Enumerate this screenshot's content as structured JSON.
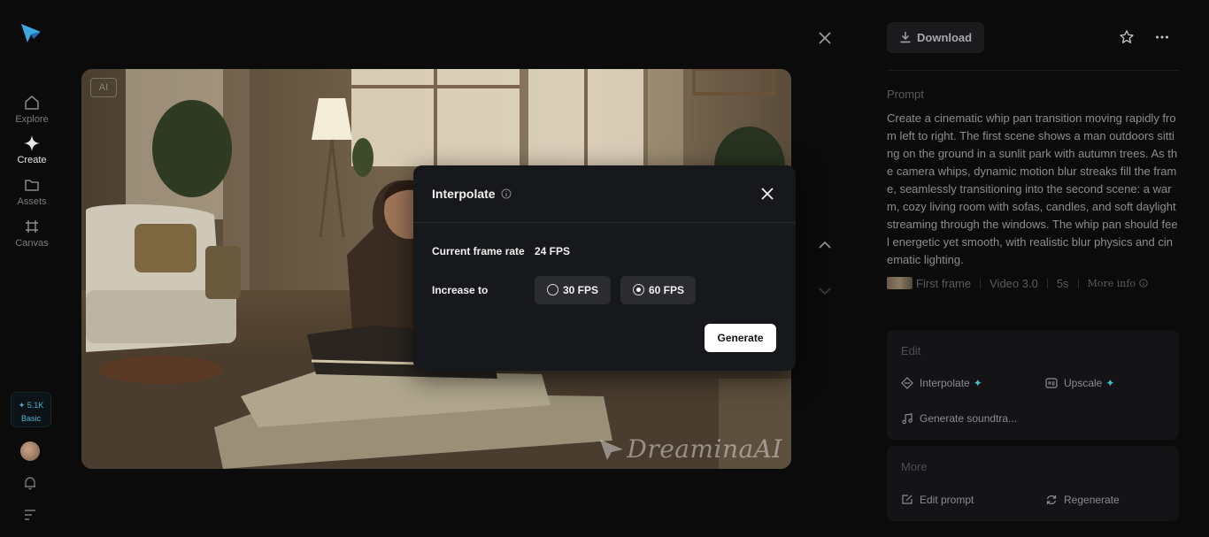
{
  "nav": {
    "items": [
      {
        "label": "Explore",
        "icon": "home-icon"
      },
      {
        "label": "Create",
        "icon": "create-icon"
      },
      {
        "label": "Assets",
        "icon": "folder-icon"
      },
      {
        "label": "Canvas",
        "icon": "canvas-icon"
      }
    ],
    "credits": {
      "amount": "✦ 5.1K",
      "plan": "Basic"
    }
  },
  "viewer": {
    "badge": "AI",
    "watermark": "DreaminaAI"
  },
  "modal": {
    "title": "Interpolate",
    "current_label": "Current frame rate",
    "current_value": "24 FPS",
    "increase_label": "Increase to",
    "options": [
      {
        "label": "30 FPS",
        "selected": false
      },
      {
        "label": "60 FPS",
        "selected": true
      }
    ],
    "generate_label": "Generate"
  },
  "panel": {
    "download_label": "Download",
    "prompt_label": "Prompt",
    "prompt_text": "Create a cinematic whip pan transition moving rapidly from left to right. The first scene shows a man outdoors sitting on the ground in a sunlit park with autumn trees. As the camera whips, dynamic motion blur streaks fill the frame, seamlessly transitioning into the second scene: a warm, cozy living room with sofas, candles, and soft daylight streaming through the windows. The whip pan should feel energetic yet smooth, with realistic blur physics and cinematic lighting.",
    "meta": {
      "first_frame": "First frame",
      "model": "Video 3.0",
      "duration": "5s",
      "more_info": "More info"
    },
    "edit": {
      "title": "Edit",
      "interpolate": "Interpolate",
      "upscale": "Upscale",
      "soundtrack": "Generate soundtra..."
    },
    "more": {
      "title": "More",
      "edit_prompt": "Edit prompt",
      "regenerate": "Regenerate"
    }
  },
  "colors": {
    "accent": "#3fbfc9",
    "modal_bg": "#17181b",
    "panel_card": "#141416"
  }
}
